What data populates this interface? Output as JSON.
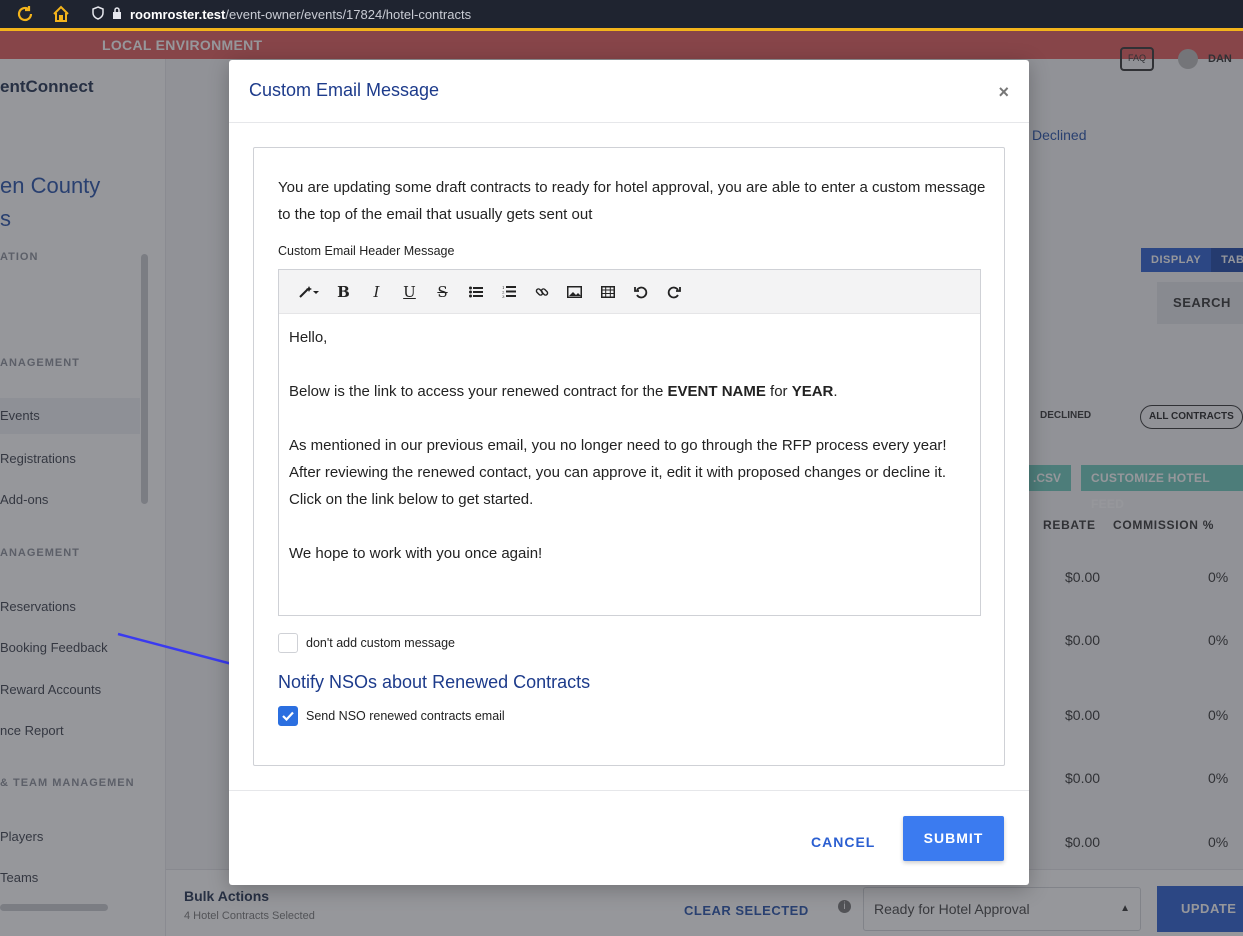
{
  "browser": {
    "host": "roomroster.test",
    "path": "/event-owner/events/17824/hotel-contracts"
  },
  "page": {
    "env_banner": "LOCAL ENVIRONMENT",
    "logo_text": "entConnect",
    "org_title_line1": "en County",
    "org_title_line2": "s",
    "sidebar": {
      "sections": [
        "ATION",
        "ANAGEMENT",
        "ANAGEMENT",
        "& TEAM MANAGEMEN"
      ],
      "items": [
        "Events",
        "Registrations",
        "Add-ons",
        "Reservations",
        "Booking Feedback",
        "Reward Accounts",
        "nce Report",
        "Players",
        "Teams"
      ]
    },
    "faq_label": "FAQ",
    "user_name": "DAN",
    "declined_link": "Declined",
    "display_label": "DISPLAY",
    "table_label": "TABL",
    "search_label": "SEARCH",
    "declined_tag": "DECLINED",
    "all_contracts_label": "ALL CONTRACTS",
    "csv_label": ".CSV",
    "customize_feed_label": "CUSTOMIZE HOTEL FEED",
    "columns": {
      "rebate": "REBATE",
      "commission": "COMMISSION %"
    },
    "rows": [
      {
        "rebate": "$0.00",
        "commission": "0%"
      },
      {
        "rebate": "$0.00",
        "commission": "0%"
      },
      {
        "rebate": "$0.00",
        "commission": "0%"
      },
      {
        "rebate": "$0.00",
        "commission": "0%"
      },
      {
        "rebate": "$0.00",
        "commission": "0%"
      }
    ],
    "bottom_bar": {
      "title": "Bulk Actions",
      "subtitle": "4 Hotel Contracts Selected",
      "clear_selected": "CLEAR SELECTED",
      "status_value": "Ready for Hotel Approval",
      "update_label": "UPDATE S"
    }
  },
  "modal": {
    "title": "Custom Email Message",
    "close_label": "×",
    "intro": "You are updating some draft contracts to ready for hotel approval, you are able to enter a custom message to the top of the email that usually gets sent out",
    "field_label": "Custom Email Header Message",
    "editor": {
      "greeting": "Hello,",
      "line2_pre": "Below is the link to access your renewed contract for the ",
      "line2_event": "EVENT NAME",
      "line2_mid": " for ",
      "line2_year": "YEAR",
      "line2_post": ".",
      "para3": "As mentioned in our previous email, you no longer need to go through the RFP process every year! After reviewing the renewed contact, you can approve it, edit it with proposed changes or decline it. Click on the link below to get started.",
      "closing": "We hope to work with you once again!"
    },
    "no_custom_checkbox": {
      "label": "don't add custom message",
      "checked": false
    },
    "nso_heading": "Notify NSOs about Renewed Contracts",
    "nso_checkbox": {
      "label": "Send NSO renewed contracts email",
      "checked": true
    },
    "cancel_label": "CANCEL",
    "submit_label": "SUBMIT"
  },
  "colors": {
    "accent": "#2b5fd1",
    "modal_title": "#1d3b8b",
    "env_banner": "#e15b5b",
    "browser_accent": "#f3b41b",
    "annotation_arrow": "#3a3af0"
  }
}
